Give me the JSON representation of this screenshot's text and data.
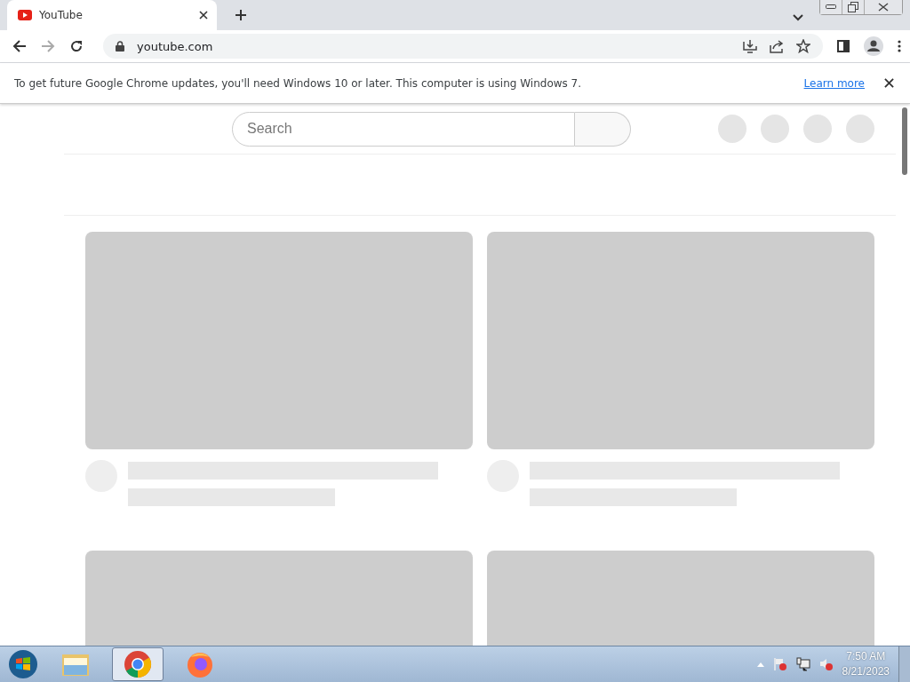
{
  "browser": {
    "tab": {
      "title": "YouTube"
    },
    "address": "youtube.com"
  },
  "infobar": {
    "message": "To get future Google Chrome updates, you'll need Windows 10 or later. This computer is using Windows 7.",
    "link": "Learn more"
  },
  "page": {
    "search": {
      "placeholder": "Search"
    }
  },
  "taskbar": {
    "apps": [
      {
        "kind": "folder",
        "selected": false
      },
      {
        "kind": "chrome",
        "selected": true
      },
      {
        "kind": "firefox",
        "selected": false
      }
    ],
    "time": "7:50 AM",
    "date": "8/21/2023"
  }
}
